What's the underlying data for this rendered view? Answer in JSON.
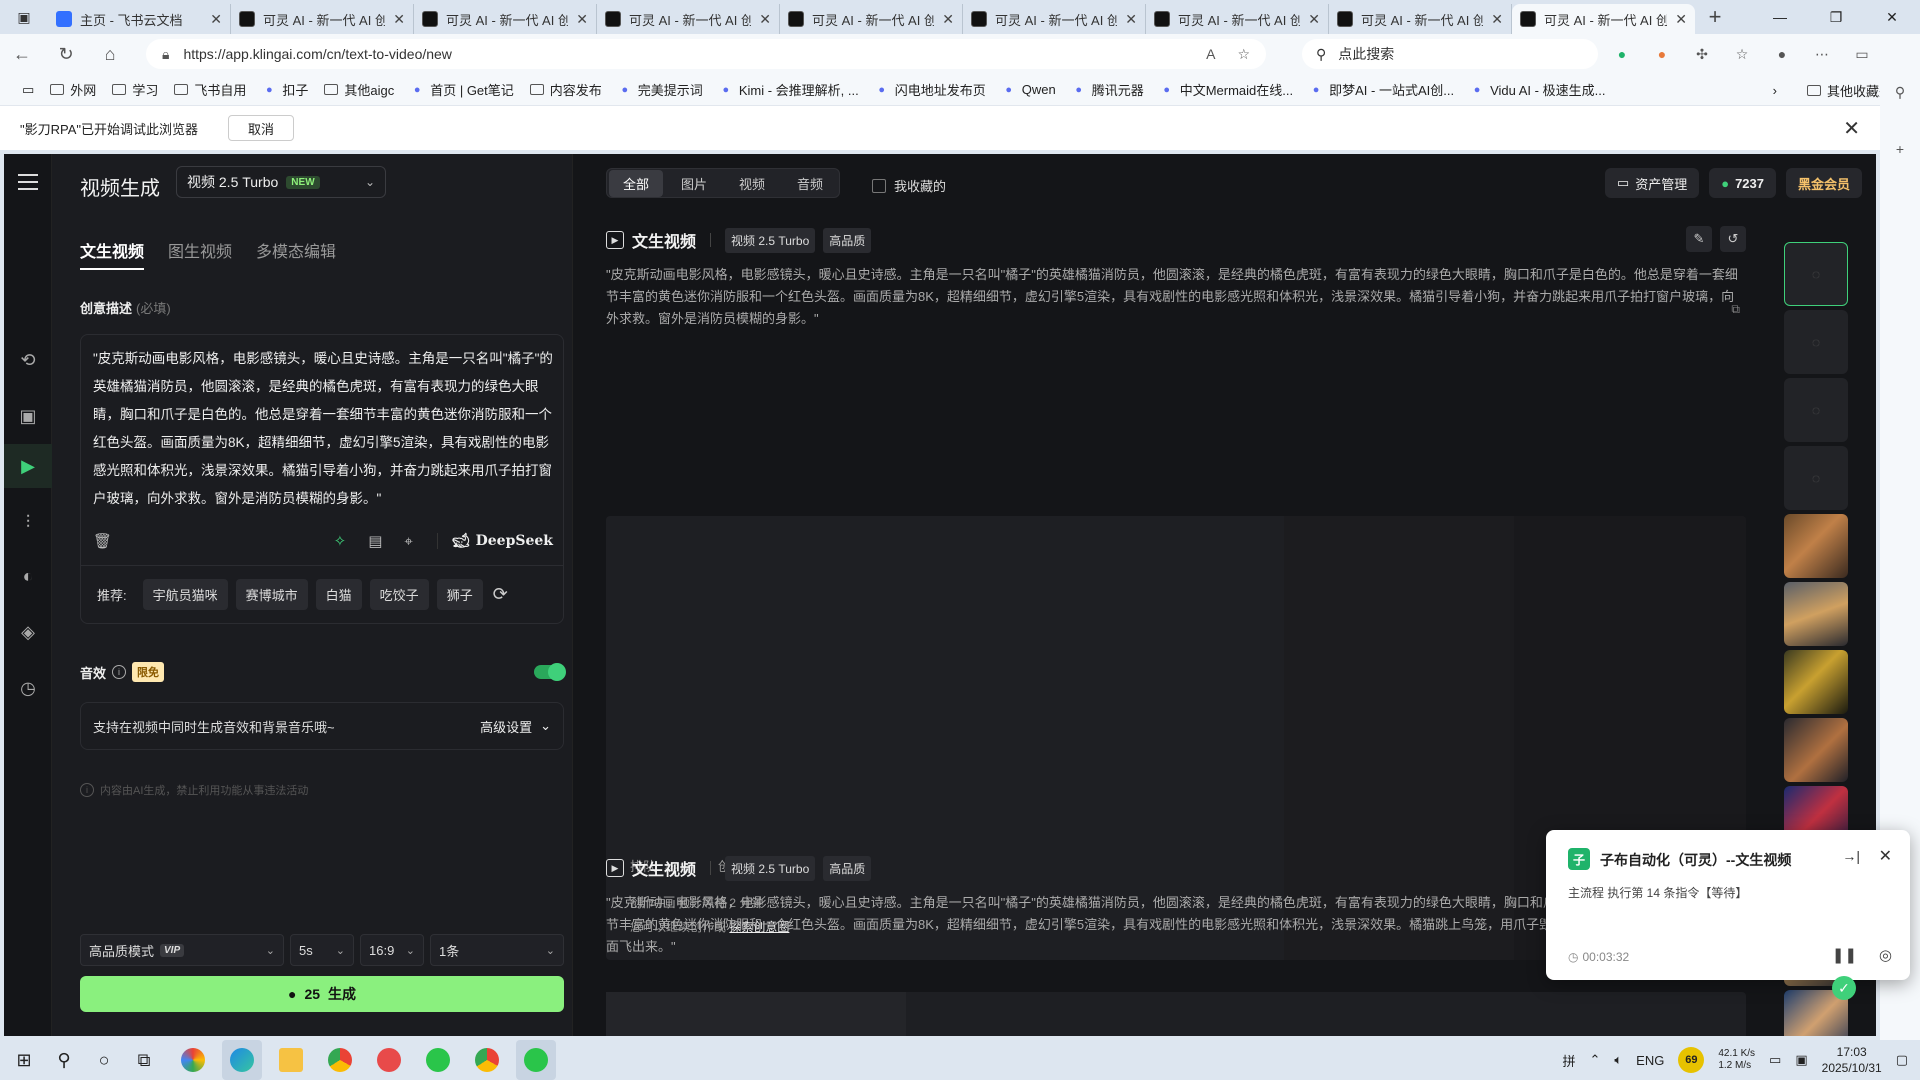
{
  "browser": {
    "tabs": [
      {
        "title": "主页 - 飞书云文档",
        "icon": "feishu-icon",
        "active": false
      },
      {
        "title": "可灵 AI - 新一代 AI 创意",
        "icon": "kling-icon",
        "active": false
      },
      {
        "title": "可灵 AI - 新一代 AI 创意",
        "icon": "kling-icon",
        "active": false
      },
      {
        "title": "可灵 AI - 新一代 AI 创意",
        "icon": "kling-icon",
        "active": false
      },
      {
        "title": "可灵 AI - 新一代 AI 创意",
        "icon": "kling-icon",
        "active": false
      },
      {
        "title": "可灵 AI - 新一代 AI 创意",
        "icon": "kling-icon",
        "active": false
      },
      {
        "title": "可灵 AI - 新一代 AI 创意",
        "icon": "kling-icon",
        "active": false
      },
      {
        "title": "可灵 AI - 新一代 AI 创意",
        "icon": "kling-icon",
        "active": false
      },
      {
        "title": "可灵 AI - 新一代 AI 创意",
        "icon": "kling-icon",
        "active": true
      }
    ],
    "url": "https://app.klingai.com/cn/text-to-video/new",
    "search_placeholder": "点此搜索",
    "bookmarks": [
      {
        "label": "外网",
        "icon": "folder-icon"
      },
      {
        "label": "学习",
        "icon": "folder-icon"
      },
      {
        "label": "飞书自用",
        "icon": "folder-icon"
      },
      {
        "label": "扣子",
        "icon": "coze-icon"
      },
      {
        "label": "其他aigc",
        "icon": "folder-icon"
      },
      {
        "label": "首页 | Get笔记",
        "icon": "getnote-icon"
      },
      {
        "label": "内容发布",
        "icon": "folder-icon"
      },
      {
        "label": "完美提示词",
        "icon": "prompt-icon"
      },
      {
        "label": "Kimi - 会推理解析, ...",
        "icon": "kimi-icon"
      },
      {
        "label": "闪电地址发布页",
        "icon": "flash-icon"
      },
      {
        "label": "Qwen",
        "icon": "qwen-icon"
      },
      {
        "label": "腾讯元器",
        "icon": "tencent-icon"
      },
      {
        "label": "中文Mermaid在线...",
        "icon": "mermaid-icon"
      },
      {
        "label": "即梦AI - 一站式AI创...",
        "icon": "jimeng-icon"
      },
      {
        "label": "Vidu AI - 极速生成...",
        "icon": "vidu-icon"
      }
    ],
    "other_bookmarks": "其他收藏夹",
    "infobar": {
      "text": "\"影刀RPA\"已开始调试此浏览器",
      "cancel": "取消"
    }
  },
  "app": {
    "title": "视频生成",
    "model": "视频 2.5 Turbo",
    "model_badge": "NEW",
    "subtabs": [
      "文生视频",
      "图生视频",
      "多模态编辑"
    ],
    "prompt_label": "创意描述",
    "prompt_required": "(必填)",
    "prompt_text": "\"皮克斯动画电影风格，电影感镜头，暖心且史诗感。主角是一只名叫\"橘子\"的英雄橘猫消防员，他圆滚滚，是经典的橘色虎斑，有富有表现力的绿色大眼睛，胸口和爪子是白色的。他总是穿着一套细节丰富的黄色迷你消防服和一个红色头盔。画面质量为8K，超精细细节，虚幻引擎5渲染，具有戏剧性的电影感光照和体积光，浅景深效果。橘猫引导着小狗，并奋力跳起来用爪子拍打窗户玻璃，向外求救。窗外是消防员模糊的身影。\"",
    "deepseek_label": "DeepSeek",
    "rec_label": "推荐:",
    "rec_chips": [
      "宇航员猫咪",
      "赛博城市",
      "白猫",
      "吃饺子",
      "狮子"
    ],
    "sfx_label": "音效",
    "sfx_badge": "限免",
    "sfx_desc": "支持在视频中同时生成音效和背景音乐哦~",
    "advanced": "高级设置",
    "disclaimer": "内容由AI生成，禁止利用功能从事违法活动",
    "opts": {
      "mode": "高品质模式",
      "mode_badge": "VIP",
      "duration": "5s",
      "ratio": "16:9",
      "count": "1条"
    },
    "generate": {
      "cost": "25",
      "label": "生成"
    }
  },
  "main": {
    "filters": [
      "全部",
      "图片",
      "视频",
      "音频"
    ],
    "favorites": "我收藏的",
    "asset_mgmt": "资产管理",
    "points": "7237",
    "vip": "黑金会员",
    "tasks": [
      {
        "title": "文生视频",
        "tags": [
          "视频 2.5 Turbo",
          "高品质"
        ],
        "prompt": "\"皮克斯动画电影风格，电影感镜头，暖心且史诗感。主角是一只名叫\"橘子\"的英雄橘猫消防员，他圆滚滚，是经典的橘色虎斑，有富有表现力的绿色大眼睛，胸口和爪子是白色的。他总是穿着一套细节丰富的黄色迷你消防服和一个红色头盔。画面质量为8K，超精细细节，虚幻引擎5渲染，具有戏剧性的电影感光照和体积光，浅景深效果。橘猫引导着小狗，并奋力跳起来用爪子拍打窗户玻璃，向外求救。窗外是消防员模糊的身影。\"",
        "queue_label": "排队",
        "create_label": "创作",
        "status": "创作中，预计等待 2 分钟",
        "hint": "您可以继续创作或",
        "link": "探索创意圈"
      },
      {
        "title": "文生视频",
        "tags": [
          "视频 2.5 Turbo",
          "高品质"
        ],
        "prompt": "\"皮克斯动画电影风格，电影感镜头，暖心且史诗感。主角是一只名叫\"橘子\"的英雄橘猫消防员，他圆滚滚，是经典的橘色虎斑，有富有表现力的绿色大眼睛，胸口和爪子是白色的。他总是穿着一套细节丰富的黄色迷你消防服和一个红色头盔。画面质量为8K，超精细细节，虚幻引擎5渲染，具有戏剧性的电影感光照和体积光，浅景深效果。橘猫跳上鸟笼，用爪子毁坏锁扣，笼子里橙色的鹦鹉从里面飞出来。\""
      }
    ]
  },
  "rpa": {
    "title": "子布自动化（可灵）--文生视频",
    "status": "主流程 执行第 14 条指令【等待】",
    "time": "00:03:32"
  },
  "taskbar": {
    "lang": "ENG",
    "ime": "拼",
    "battery": "69",
    "net_up": "42.1 K/s",
    "net_down": "1.2 M/s",
    "time": "17:03",
    "date": "2025/10/31"
  },
  "colors": {
    "accent_green": "#3fd07a",
    "generate_btn": "#8af07e",
    "vip_gold": "#f5c26b",
    "bg_dark": "#141518"
  }
}
